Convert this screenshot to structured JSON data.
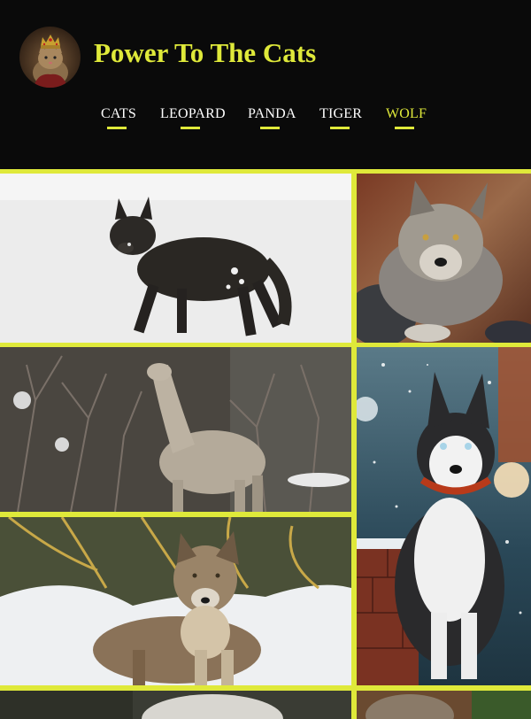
{
  "site": {
    "title": "Power To The Cats",
    "logo_icon": "crowned-cat-logo-icon"
  },
  "nav": {
    "items": [
      {
        "label": "CATS",
        "active": false
      },
      {
        "label": "LEOPARD",
        "active": false
      },
      {
        "label": "PANDA",
        "active": false
      },
      {
        "label": "TIGER",
        "active": false
      },
      {
        "label": "WOLF",
        "active": true
      }
    ]
  },
  "gallery": {
    "images": [
      {
        "subject": "black wolf walking on snow"
      },
      {
        "subject": "grey wolf portrait lying on rocks"
      },
      {
        "subject": "wolf howling in bare forest"
      },
      {
        "subject": "siberian husky sitting in snowfall with red collar"
      },
      {
        "subject": "grey wolf standing in snow among branches"
      },
      {
        "subject": "wolf partially visible"
      },
      {
        "subject": "wolf partially visible"
      }
    ]
  },
  "colors": {
    "accent": "#dfe93a",
    "background": "#0a0a0a",
    "nav_text": "#ffffff"
  }
}
